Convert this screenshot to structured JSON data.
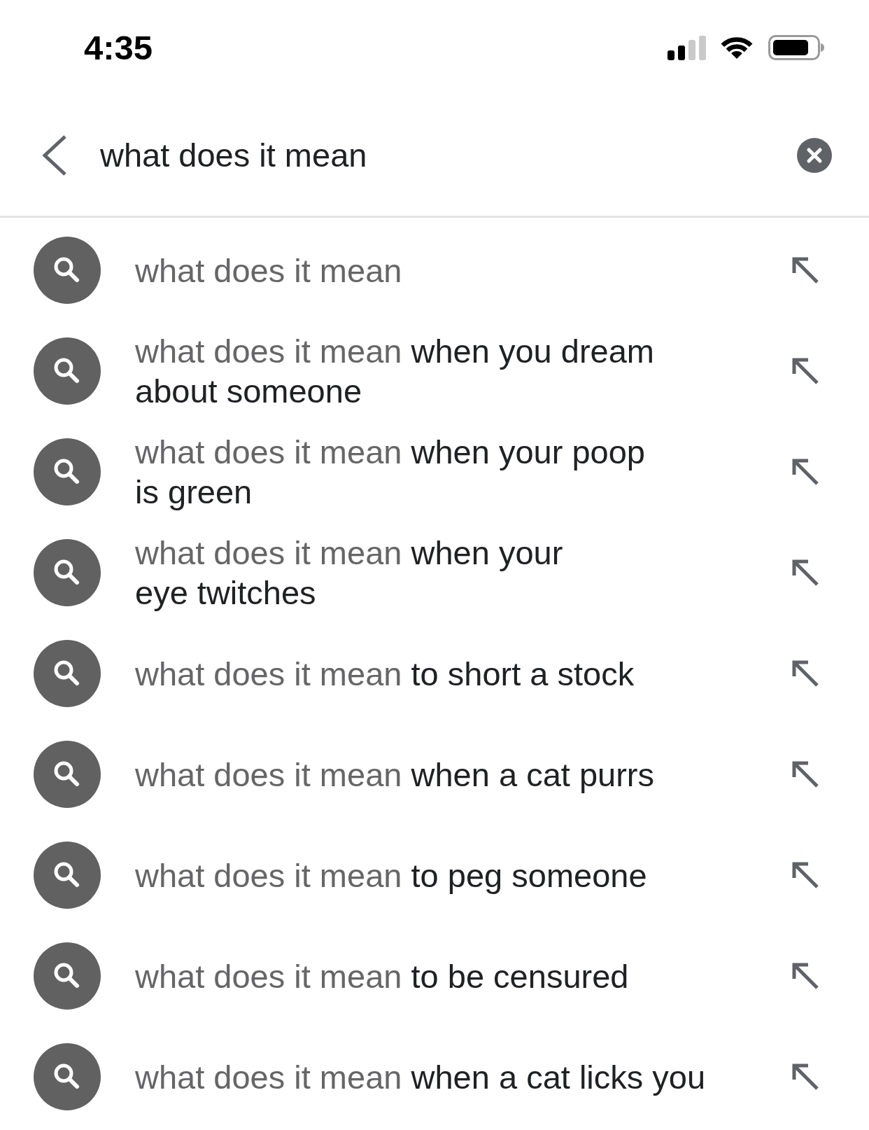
{
  "status_bar": {
    "time": "4:35"
  },
  "search_bar": {
    "value": "what does it mean"
  },
  "suggestions": [
    {
      "query": "what does it mean"
    },
    {
      "query": "what does it mean",
      "completion": "when you dream\nabout someone"
    },
    {
      "query": "what does it mean",
      "completion": "when your poop\nis green"
    },
    {
      "query": "what does it mean",
      "completion": "when your\neye twitches"
    },
    {
      "query": "what does it mean",
      "completion": "to short a stock"
    },
    {
      "query": "what does it mean",
      "completion": "when a cat purrs"
    },
    {
      "query": "what does it mean",
      "completion": "to peg someone"
    },
    {
      "query": "what does it mean",
      "completion": "to be censured"
    },
    {
      "query": "what does it mean",
      "completion": "when a cat licks you"
    }
  ]
}
